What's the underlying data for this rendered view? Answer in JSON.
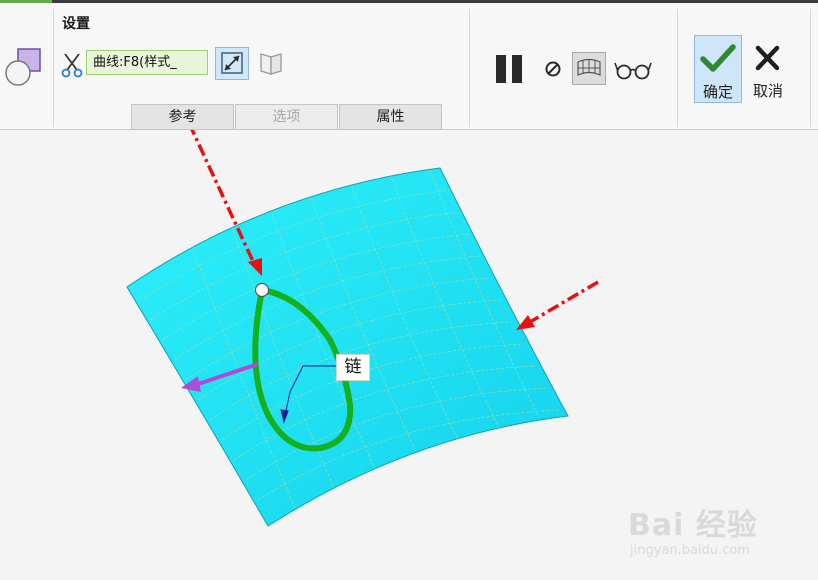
{
  "toolbar": {
    "settings_title": "设置",
    "curve_field_value": "曲线:F8(样式_",
    "tabs": [
      {
        "label": "参考",
        "enabled": true
      },
      {
        "label": "选项",
        "enabled": false
      },
      {
        "label": "属性",
        "enabled": true
      }
    ],
    "ok_label": "确定",
    "cancel_label": "取消"
  },
  "canvas": {
    "chain_label": "链",
    "colors": {
      "surface": "#22ddf0",
      "chain_curve": "#15b01c",
      "annotation_arrow": "#e81010",
      "normal_arrow": "#b24ad8"
    }
  },
  "watermark": {
    "logo": "Bai  经验",
    "url": "jingyan.baidu.com"
  }
}
